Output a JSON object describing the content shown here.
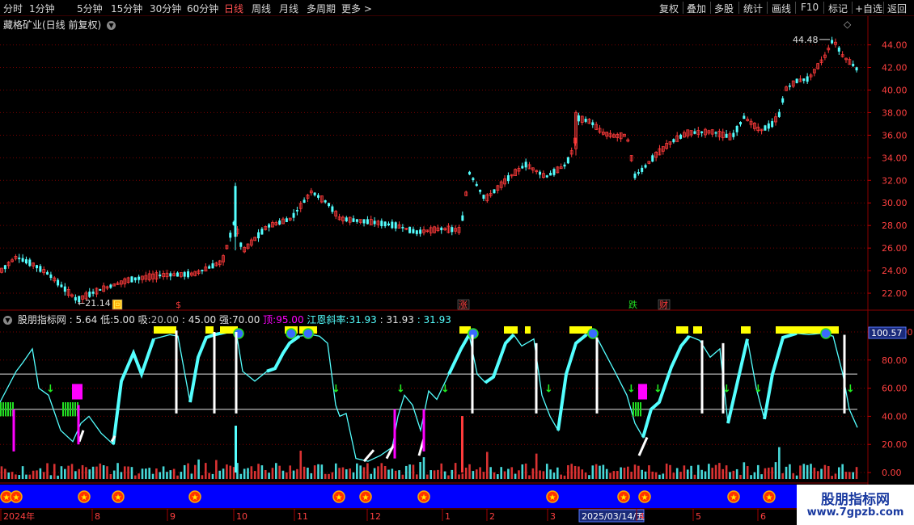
{
  "toolbar": {
    "periods": [
      "分时",
      "1分钟",
      "5分钟",
      "15分钟",
      "30分钟",
      "60分钟",
      "日线",
      "周线",
      "月线",
      "多周期",
      "更多 >"
    ],
    "active_period": "日线",
    "right": [
      "复权",
      "叠加",
      "多股",
      "统计",
      "画线",
      "F10",
      "标记",
      "+自选",
      "返回"
    ]
  },
  "stock": {
    "title": "藏格矿业(日线 前复权)"
  },
  "price_axis": {
    "ticks": [
      "44.00",
      "42.00",
      "40.00",
      "38.00",
      "36.00",
      "34.00",
      "32.00",
      "30.00",
      "28.00",
      "26.00",
      "24.00",
      "22.00"
    ],
    "min": 20.5,
    "max": 45.4
  },
  "markers": {
    "high_label": "44.48",
    "low_label": "21.14"
  },
  "events": [
    "回",
    "$",
    "涨",
    "跌",
    "财"
  ],
  "indicator": {
    "name": "股朋指标网",
    "v1": "5.64",
    "low_label": "低:",
    "low": "5.00",
    "xi_label": "吸:",
    "xi": "20.00",
    "v2": "45.00",
    "qiang_label": "强:",
    "qiang": "70.00",
    "ding_label": "顶:",
    "ding": "95.00",
    "slope_label": "江恩斜率:",
    "slope1": "31.93",
    "slope2": "31.93",
    "slope3": "31.93",
    "current_value": "100.57",
    "axis_ticks": [
      "100.00",
      "80.00",
      "60.00",
      "40.00",
      "20.00",
      "0.00"
    ]
  },
  "date_axis": {
    "labels": [
      "2024年",
      "8",
      "9",
      "10",
      "11",
      "12",
      "1",
      "2",
      "3",
      "2025/03/14/五",
      "4",
      "5",
      "6"
    ]
  },
  "watermark": {
    "title": "股朋指标网",
    "url": "www.7gpzb.com"
  },
  "colors": {
    "up": "#ff3b3b",
    "down": "#54ffff",
    "bg": "#000000",
    "grid_red": "#7a0000",
    "yellow": "#ffff00",
    "magenta": "#ff00ff",
    "blue_band": "#0000ff"
  }
}
